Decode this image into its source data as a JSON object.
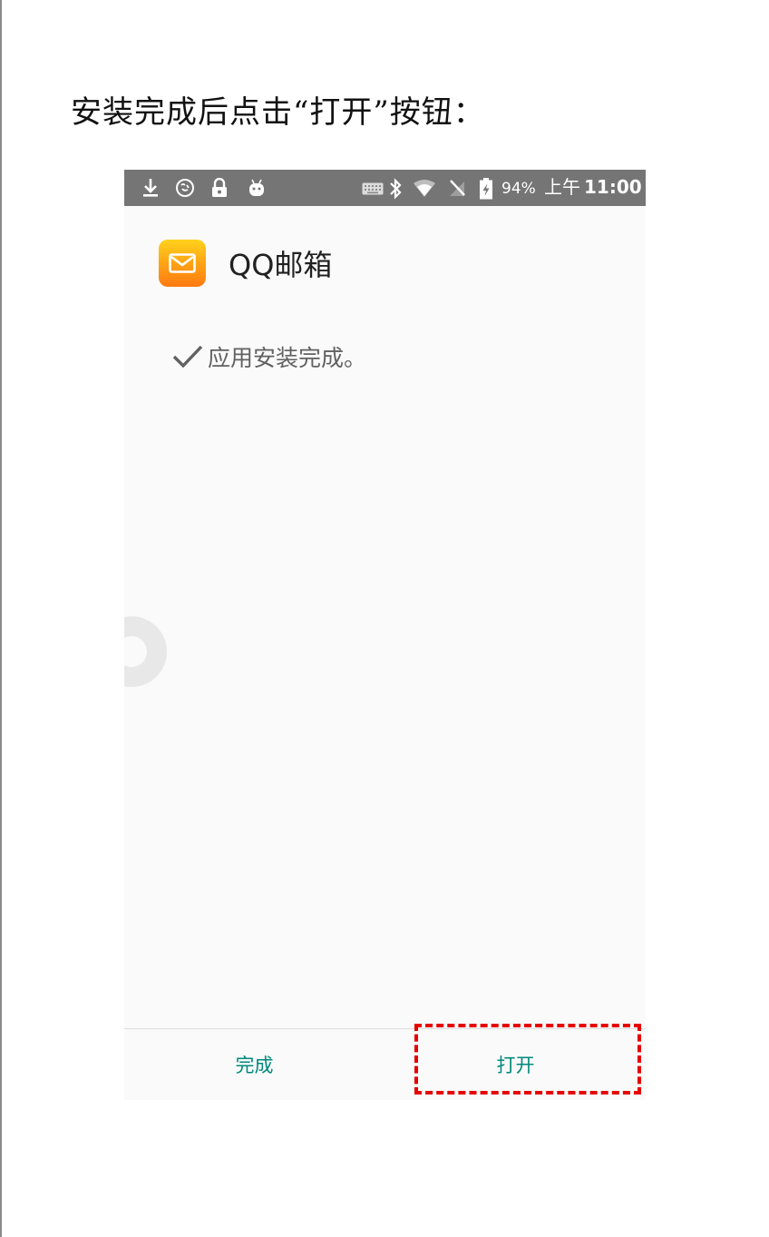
{
  "instruction": "安装完成后点击“打开”按钮：",
  "status_bar": {
    "battery": "94%",
    "time_prefix": "上午",
    "time": "11:00",
    "left_icons": [
      "download-icon",
      "sync-icon",
      "lock-icon",
      "android-icon"
    ],
    "right_icons": [
      "keyboard-icon",
      "bluetooth-icon",
      "wifi-icon",
      "no-sim-icon",
      "battery-charging-icon"
    ]
  },
  "app": {
    "name": "QQ邮箱",
    "icon": "mail-envelope-icon"
  },
  "result": {
    "message": "应用安装完成。",
    "icon": "checkmark-icon"
  },
  "buttons": {
    "done": "完成",
    "open": "打开"
  },
  "colors": {
    "status_bar": "#757575",
    "accent": "#00897b",
    "highlight": "#e60000",
    "icon_gradient_top": "#ffd21c",
    "icon_gradient_bottom": "#ff7a12"
  }
}
